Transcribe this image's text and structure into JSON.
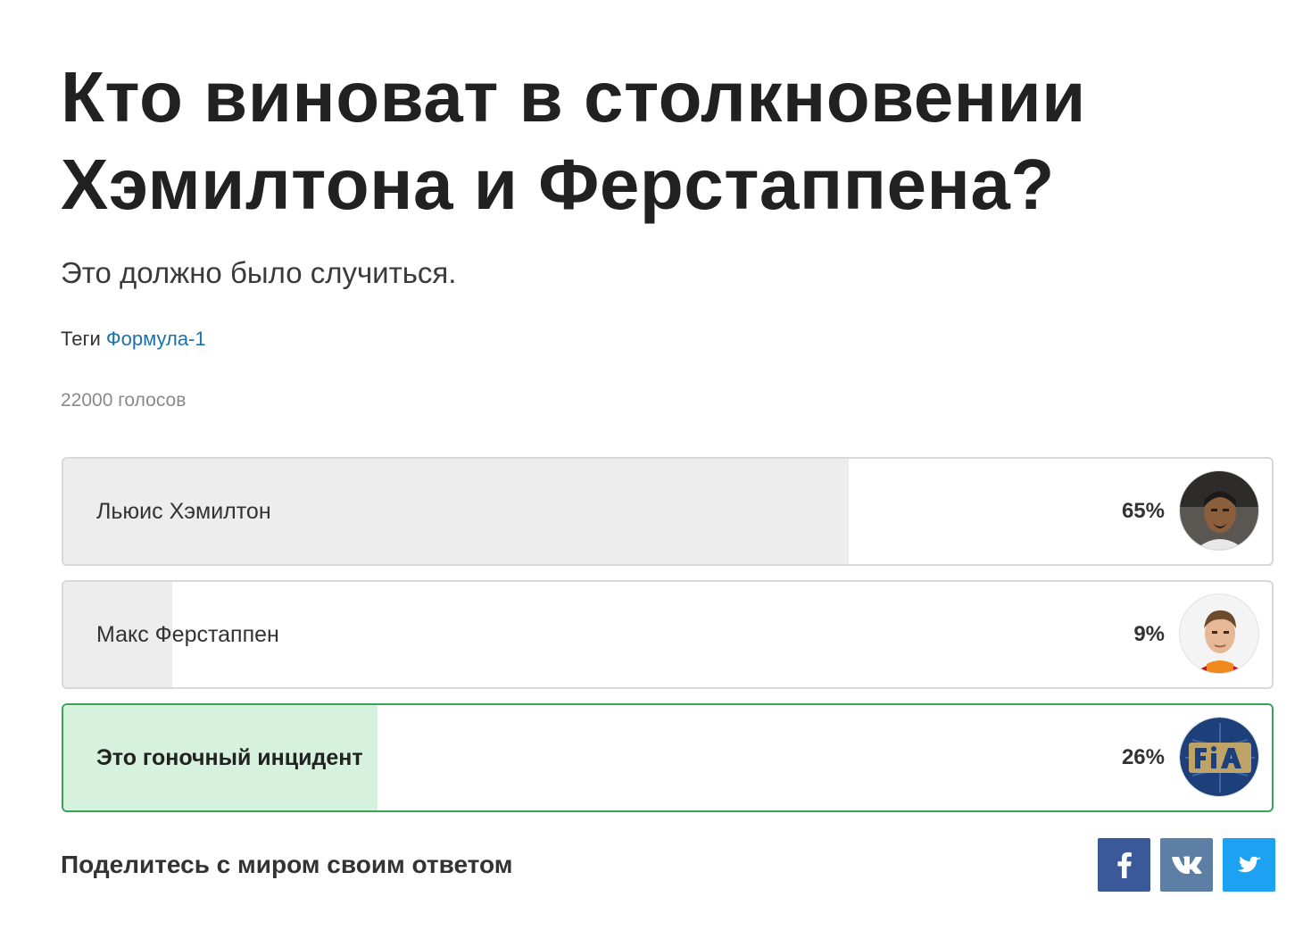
{
  "title": "Кто виноват в столкновении Хэмилтона и Ферстаппена?",
  "subtitle": "Это должно было случиться.",
  "tags": {
    "label": "Теги",
    "items": [
      "Формула-1"
    ]
  },
  "votes_text": "22000 голосов",
  "options": [
    {
      "label": "Льюис Хэмилтон",
      "percent_text": "65%",
      "fraction": 0.65,
      "selected": false,
      "icon": "hamilton-avatar"
    },
    {
      "label": "Макс Ферстаппен",
      "percent_text": "9%",
      "fraction": 0.09,
      "selected": false,
      "icon": "verstappen-avatar"
    },
    {
      "label": "Это гоночный инцидент",
      "percent_text": "26%",
      "fraction": 0.26,
      "selected": true,
      "icon": "fia-logo"
    }
  ],
  "share": {
    "text": "Поделитесь с миром своим ответом",
    "buttons": [
      {
        "name": "facebook",
        "icon": "facebook-icon",
        "color": "#3b5998"
      },
      {
        "name": "vk",
        "icon": "vk-icon",
        "color": "#5d7fa5"
      },
      {
        "name": "twitter",
        "icon": "twitter-icon",
        "color": "#1da1f2"
      }
    ]
  },
  "colors": {
    "selected_border": "#3aa35a",
    "selected_fill": "#d6f1dd",
    "fill": "#ededed",
    "tag_link": "#1f6fa8"
  }
}
